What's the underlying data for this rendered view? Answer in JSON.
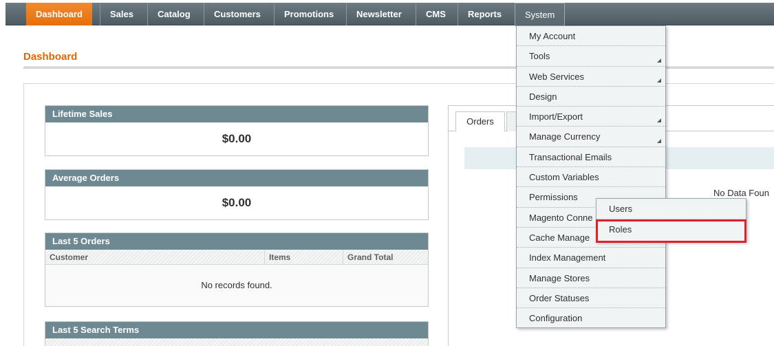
{
  "nav": {
    "items": [
      {
        "label": "Dashboard"
      },
      {
        "label": "Sales"
      },
      {
        "label": "Catalog"
      },
      {
        "label": "Customers"
      },
      {
        "label": "Promotions"
      },
      {
        "label": "Newsletter"
      },
      {
        "label": "CMS"
      },
      {
        "label": "Reports"
      },
      {
        "label": "System"
      }
    ]
  },
  "page": {
    "title": "Dashboard"
  },
  "boxes": {
    "lifetime_sales": {
      "title": "Lifetime Sales",
      "value": "$0.00"
    },
    "average_orders": {
      "title": "Average Orders",
      "value": "$0.00"
    },
    "last_orders": {
      "title": "Last 5 Orders",
      "columns": [
        "Customer",
        "Items",
        "Grand Total"
      ],
      "empty": "No records found."
    },
    "last_search": {
      "title": "Last 5 Search Terms"
    }
  },
  "right": {
    "tab_orders": "Orders",
    "no_data": "No Data Foun"
  },
  "system_menu": {
    "items": [
      {
        "label": "My Account"
      },
      {
        "label": "Tools"
      },
      {
        "label": "Web Services"
      },
      {
        "label": "Design"
      },
      {
        "label": "Import/Export"
      },
      {
        "label": "Manage Currency"
      },
      {
        "label": "Transactional Emails"
      },
      {
        "label": "Custom Variables"
      },
      {
        "label": "Permissions"
      },
      {
        "label": "Magento Conne"
      },
      {
        "label": "Cache Manage"
      },
      {
        "label": "Index Management"
      },
      {
        "label": "Manage Stores"
      },
      {
        "label": "Order Statuses"
      },
      {
        "label": "Configuration"
      }
    ]
  },
  "permissions_menu": {
    "items": [
      {
        "label": "Users"
      },
      {
        "label": "Roles"
      }
    ]
  },
  "colors": {
    "accent": "#e26703",
    "active_tab": "#eb7b1e",
    "box_header": "#6f8992",
    "highlight": "#e2202a"
  }
}
